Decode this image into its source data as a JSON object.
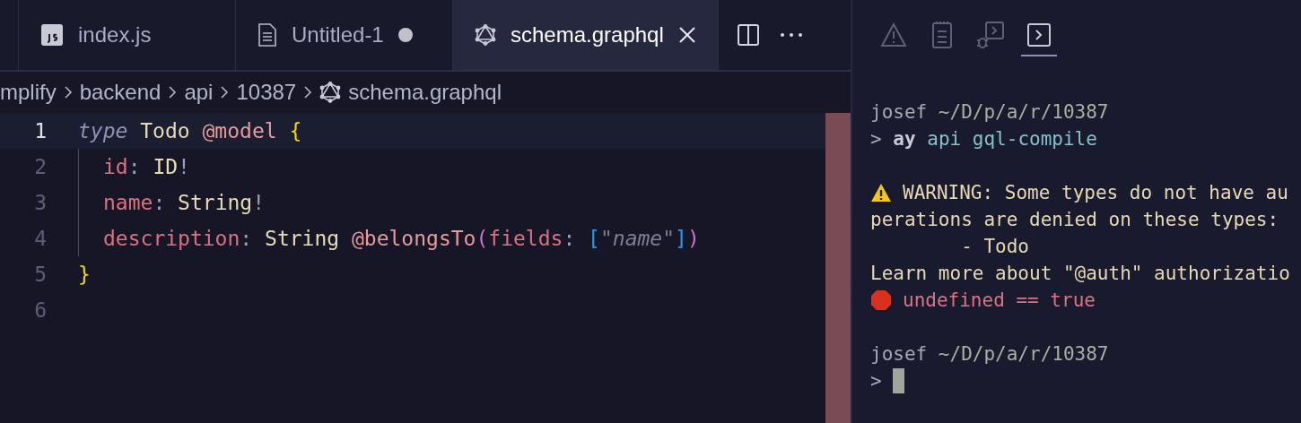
{
  "tabs": [
    {
      "label": "index.js",
      "selected": false,
      "modified": false,
      "closable": false
    },
    {
      "label": "Untitled-1",
      "selected": false,
      "modified": true,
      "closable": false
    },
    {
      "label": "schema.graphql",
      "selected": true,
      "modified": false,
      "closable": true
    }
  ],
  "breadcrumbs": [
    "mplify",
    "backend",
    "api",
    "10387",
    "schema.graphql"
  ],
  "code_lines": [
    {
      "number": "1",
      "current": true,
      "indented": false,
      "tokens": [
        {
          "kind": "keyword",
          "text": "type "
        },
        {
          "kind": "type",
          "text": "Todo "
        },
        {
          "kind": "directive",
          "text": "@model "
        },
        {
          "kind": "brace",
          "text": "{"
        }
      ]
    },
    {
      "number": "2",
      "current": false,
      "indented": true,
      "tokens": [
        {
          "kind": "field",
          "text": "id"
        },
        {
          "kind": "punct",
          "text": ": "
        },
        {
          "kind": "type",
          "text": "ID"
        },
        {
          "kind": "punct",
          "text": "!"
        }
      ]
    },
    {
      "number": "3",
      "current": false,
      "indented": true,
      "tokens": [
        {
          "kind": "field",
          "text": "name"
        },
        {
          "kind": "punct",
          "text": ": "
        },
        {
          "kind": "type",
          "text": "String"
        },
        {
          "kind": "punct",
          "text": "!"
        }
      ]
    },
    {
      "number": "4",
      "current": false,
      "indented": true,
      "tokens": [
        {
          "kind": "field",
          "text": "description"
        },
        {
          "kind": "punct",
          "text": ": "
        },
        {
          "kind": "type",
          "text": "String "
        },
        {
          "kind": "directive",
          "text": "@belongsTo"
        },
        {
          "kind": "paren",
          "text": "("
        },
        {
          "kind": "field",
          "text": "fields"
        },
        {
          "kind": "punct",
          "text": ": "
        },
        {
          "kind": "bracket",
          "text": "["
        },
        {
          "kind": "string",
          "text": "\"name\""
        },
        {
          "kind": "bracket",
          "text": "]"
        },
        {
          "kind": "paren",
          "text": ")"
        }
      ]
    },
    {
      "number": "5",
      "current": false,
      "indented": false,
      "tokens": [
        {
          "kind": "brace",
          "text": "}"
        }
      ]
    },
    {
      "number": "6",
      "current": false,
      "indented": false
    }
  ],
  "panel_tabs": [
    {
      "kind": "problems",
      "selected": false
    },
    {
      "kind": "output",
      "selected": false
    },
    {
      "kind": "debug",
      "selected": false
    },
    {
      "kind": "terminal",
      "selected": true
    }
  ],
  "terminal_lines": [
    {
      "kind": "blank"
    },
    {
      "kind": "prompt",
      "segments": [
        {
          "kind": "user",
          "text": "josef"
        },
        {
          "kind": "path",
          "text": " ~/D/p/a/r/10387"
        }
      ]
    },
    {
      "kind": "command",
      "segments": [
        {
          "kind": "arrow",
          "text": ">"
        },
        {
          "kind": "cmd",
          "text": " ay"
        },
        {
          "kind": "arg",
          "text": " api gql-compile"
        }
      ]
    },
    {
      "kind": "blank"
    },
    {
      "kind": "warning",
      "segments": [
        {
          "kind": "info",
          "text": "WARNING: Some types do not have au"
        }
      ]
    },
    {
      "kind": "plain",
      "segments": [
        {
          "kind": "info",
          "text": "perations are denied on these types:"
        }
      ]
    },
    {
      "kind": "plain",
      "segments": [
        {
          "kind": "info",
          "text": "        - Todo"
        }
      ]
    },
    {
      "kind": "plain",
      "segments": [
        {
          "kind": "info",
          "text": "Learn more about \"@auth\" authorizatio"
        }
      ]
    },
    {
      "kind": "error",
      "segments": [
        {
          "kind": "err",
          "text": "undefined == true"
        }
      ]
    },
    {
      "kind": "blank"
    },
    {
      "kind": "prompt",
      "segments": [
        {
          "kind": "user",
          "text": "josef"
        },
        {
          "kind": "path",
          "text": " ~/D/p/a/r/10387"
        }
      ]
    },
    {
      "kind": "input",
      "segments": [
        {
          "kind": "arrow",
          "text": ">"
        }
      ]
    }
  ]
}
